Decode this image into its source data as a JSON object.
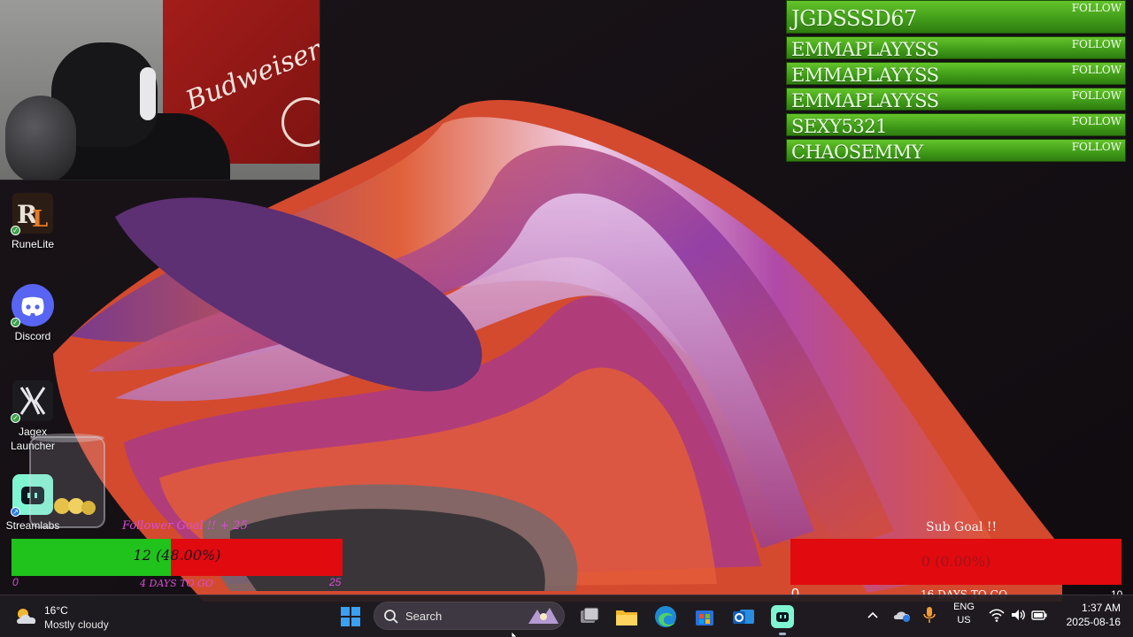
{
  "desktop_icons": [
    {
      "name": "runelite",
      "label": "RuneLite"
    },
    {
      "name": "discord",
      "label": "Discord"
    },
    {
      "name": "jagex",
      "label": "Jagex\nLauncher"
    },
    {
      "name": "streamlabs",
      "label": "Streamlabs"
    }
  ],
  "webcam": {
    "flag_text": "Budweiser"
  },
  "follower_list": {
    "items": [
      {
        "name": "JGDSSSD67",
        "tag": "FOLLOW"
      },
      {
        "name": "EMMAPLAYYSS",
        "tag": "FOLLOW"
      },
      {
        "name": "EMMAPLAYYSS",
        "tag": "FOLLOW"
      },
      {
        "name": "EMMAPLAYYSS",
        "tag": "FOLLOW"
      },
      {
        "name": "SEXY5321",
        "tag": "FOLLOW"
      },
      {
        "name": "CHAOSEMMY",
        "tag": "FOLLOW"
      }
    ]
  },
  "follower_goal": {
    "title": "Follower Goal !! + 25",
    "progress_text": "12 (48.00%)",
    "progress_fraction": 0.48,
    "min": "0",
    "max": "25",
    "days_left": "4 DAYS TO GO",
    "fill_color": "#20c21c",
    "bar_color": "#e10a0f"
  },
  "sub_goal": {
    "title": "Sub Goal !!",
    "progress_text": "0 (0.00%)",
    "progress_fraction": 0.0,
    "min": "0",
    "max": "10",
    "days_left": "16 DAYS TO GO"
  },
  "taskbar": {
    "weather": {
      "temp": "16°C",
      "condition": "Mostly cloudy"
    },
    "search_placeholder": "Search",
    "pinned": [
      "start-icon",
      "task-view-icon",
      "file-explorer-icon",
      "edge-icon",
      "store-icon",
      "outlook-icon",
      "streamlabs-icon"
    ],
    "lang": {
      "line1": "ENG",
      "line2": "US"
    },
    "clock": {
      "time": "1:37 AM",
      "date": "2025-08-16"
    }
  }
}
